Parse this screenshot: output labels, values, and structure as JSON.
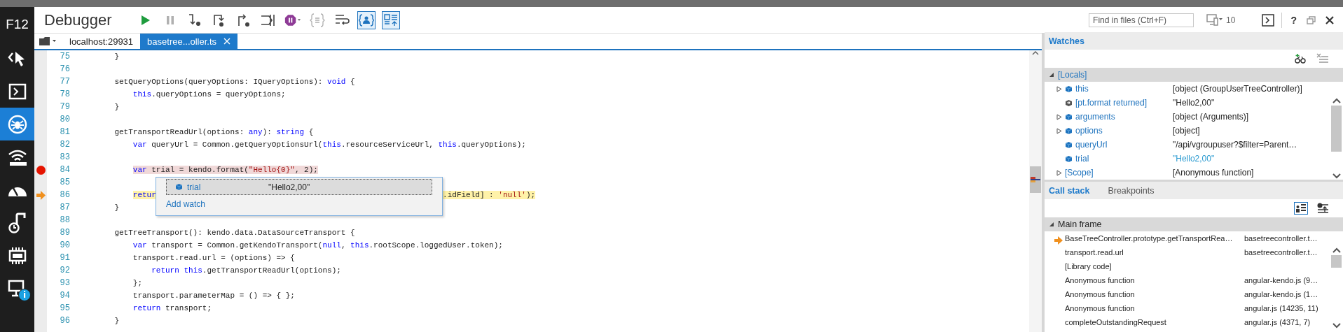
{
  "app_label": "F12",
  "rail": [
    {
      "kind": "pointer",
      "selected": false
    },
    {
      "kind": "console",
      "selected": false
    },
    {
      "kind": "debugger",
      "selected": true
    },
    {
      "kind": "network",
      "selected": false
    },
    {
      "kind": "performance",
      "selected": false
    },
    {
      "kind": "memory",
      "selected": false
    },
    {
      "kind": "emulation",
      "selected": false
    },
    {
      "kind": "devices",
      "selected": false,
      "badge": "i"
    }
  ],
  "title": "Debugger",
  "toolbar": [
    {
      "kind": "continue",
      "disabled": false,
      "on": false
    },
    {
      "kind": "break",
      "disabled": true,
      "on": false
    },
    {
      "kind": "step-into",
      "disabled": false,
      "on": false
    },
    {
      "kind": "step-over",
      "disabled": false,
      "on": false
    },
    {
      "kind": "step-out",
      "disabled": false,
      "on": false
    },
    {
      "kind": "break-worker",
      "disabled": false,
      "on": false
    },
    {
      "kind": "exceptions",
      "disabled": false,
      "on": false
    },
    {
      "kind": "pretty-print",
      "disabled": true,
      "on": false
    },
    {
      "kind": "word-wrap",
      "disabled": false,
      "on": false
    },
    {
      "kind": "just-my-code",
      "disabled": false,
      "on": true
    },
    {
      "kind": "source-maps",
      "disabled": false,
      "on": true
    }
  ],
  "search": {
    "placeholder": "Find in files (Ctrl+F)"
  },
  "target": {
    "label": "10"
  },
  "help": "?",
  "file_tabs": [
    {
      "label": "localhost:29931",
      "selected": false,
      "closable": false
    },
    {
      "label": "basetree...oller.ts",
      "selected": true,
      "closable": true
    }
  ],
  "code": {
    "lines": [
      {
        "n": "75",
        "breakpoint": false,
        "current": false,
        "tokens": [
          {
            "t": "    }",
            "kind": "plain"
          }
        ]
      },
      {
        "n": "76",
        "breakpoint": false,
        "current": false
      },
      {
        "n": "77",
        "breakpoint": false,
        "current": false,
        "tokens": [
          {
            "t": "    setQueryOptions(queryOptions: IQueryOptions): ",
            "kind": "plain"
          },
          {
            "t": "void",
            "kind": "keyword"
          },
          {
            "t": " {",
            "kind": "plain"
          }
        ]
      },
      {
        "n": "78",
        "breakpoint": false,
        "current": false,
        "tokens": [
          {
            "t": "        this",
            "kind": "keyword"
          },
          {
            "t": ".queryOptions = queryOptions;",
            "kind": "plain"
          }
        ]
      },
      {
        "n": "79",
        "breakpoint": false,
        "current": false,
        "tokens": [
          {
            "t": "    }",
            "kind": "plain"
          }
        ]
      },
      {
        "n": "80",
        "breakpoint": false,
        "current": false
      },
      {
        "n": "81",
        "breakpoint": false,
        "current": false,
        "tokens": [
          {
            "t": "    getTransportReadUrl(options: ",
            "kind": "plain"
          },
          {
            "t": "any",
            "kind": "keyword"
          },
          {
            "t": "): ",
            "kind": "plain"
          },
          {
            "t": "string",
            "kind": "keyword"
          },
          {
            "t": " {",
            "kind": "plain"
          }
        ]
      },
      {
        "n": "82",
        "breakpoint": false,
        "current": false,
        "tokens": [
          {
            "t": "        var",
            "kind": "keyword"
          },
          {
            "t": " queryUrl = Common.getQueryOptionsUrl(",
            "kind": "plain"
          },
          {
            "t": "this",
            "kind": "keyword"
          },
          {
            "t": ".resourceServiceUrl, ",
            "kind": "plain"
          },
          {
            "t": "this",
            "kind": "keyword"
          },
          {
            "t": ".queryOptions);",
            "kind": "plain"
          }
        ]
      },
      {
        "n": "83",
        "breakpoint": false,
        "current": false
      },
      {
        "n": "84",
        "breakpoint": true,
        "current": false,
        "tokens": [
          {
            "t": "        var",
            "kind": "keyword"
          },
          {
            "t": " trial = kendo.format(",
            "kind": "plain"
          },
          {
            "t": "\"Hello{0}\"",
            "kind": "string"
          },
          {
            "t": ", 2);",
            "kind": "plain"
          }
        ]
      },
      {
        "n": "85",
        "breakpoint": false,
        "current": false
      },
      {
        "n": "86",
        "breakpoint": false,
        "current": true,
        "tokens": [
          {
            "t": "        retur",
            "kind": "keyword"
          }
        ],
        "tail": [
          {
            "t": ".idField] : ",
            "kind": "plain"
          },
          {
            "t": "'null'",
            "kind": "string"
          },
          {
            "t": ");",
            "kind": "plain"
          }
        ]
      },
      {
        "n": "87",
        "breakpoint": false,
        "current": false,
        "tokens": [
          {
            "t": "    }",
            "kind": "plain"
          }
        ]
      },
      {
        "n": "88",
        "breakpoint": false,
        "current": false
      },
      {
        "n": "89",
        "breakpoint": false,
        "current": false,
        "tokens": [
          {
            "t": "    getTreeTransport(): kendo.data.DataSourceTransport {",
            "kind": "plain"
          }
        ]
      },
      {
        "n": "90",
        "breakpoint": false,
        "current": false,
        "tokens": [
          {
            "t": "        var",
            "kind": "keyword"
          },
          {
            "t": " transport = Common.getKendoTransport(",
            "kind": "plain"
          },
          {
            "t": "null",
            "kind": "keyword"
          },
          {
            "t": ", ",
            "kind": "plain"
          },
          {
            "t": "this",
            "kind": "keyword"
          },
          {
            "t": ".rootScope.loggedUser.token);",
            "kind": "plain"
          }
        ]
      },
      {
        "n": "91",
        "breakpoint": false,
        "current": false,
        "tokens": [
          {
            "t": "        transport.read.url = (options) => {",
            "kind": "plain"
          }
        ]
      },
      {
        "n": "92",
        "breakpoint": false,
        "current": false,
        "tokens": [
          {
            "t": "            return this",
            "kind": "keyword"
          },
          {
            "t": ".getTransportReadUrl(options);",
            "kind": "plain"
          }
        ]
      },
      {
        "n": "93",
        "breakpoint": false,
        "current": false,
        "tokens": [
          {
            "t": "        };",
            "kind": "plain"
          }
        ]
      },
      {
        "n": "94",
        "breakpoint": false,
        "current": false,
        "tokens": [
          {
            "t": "        transport.parameterMap = () => { };",
            "kind": "plain"
          }
        ]
      },
      {
        "n": "95",
        "breakpoint": false,
        "current": false,
        "tokens": [
          {
            "t": "        return",
            "kind": "keyword"
          },
          {
            "t": " transport;",
            "kind": "plain"
          }
        ]
      },
      {
        "n": "96",
        "breakpoint": false,
        "current": false,
        "tokens": [
          {
            "t": "    }",
            "kind": "plain"
          }
        ]
      }
    ]
  },
  "datatip": {
    "name": "trial",
    "value": "\"Hello2,00\"",
    "action": "Add watch"
  },
  "watches": {
    "title": "Watches",
    "scope": {
      "label": "[Locals]",
      "expanded": true,
      "selected": true,
      "children": [
        {
          "name": "this",
          "value": "[object (GroupUserTreeController)]",
          "kind": "object",
          "expanded": false,
          "changed": false
        },
        {
          "name": "[pt.format returned]",
          "value": "\"Hello2,00\"",
          "kind": "returned",
          "changed": false
        },
        {
          "name": "arguments",
          "value": "[object (Arguments)]",
          "kind": "object",
          "expanded": false,
          "changed": false
        },
        {
          "name": "options",
          "value": "[object]",
          "kind": "object",
          "expanded": false,
          "changed": false
        },
        {
          "name": "queryUrl",
          "value": "\"/api/vgroupuser?$filter=Parent…",
          "kind": "value",
          "changed": false
        },
        {
          "name": "trial",
          "value": "\"Hello2,00\"",
          "kind": "value",
          "changed": true
        },
        {
          "name": "[Scope]",
          "value": "[Anonymous function]",
          "kind": "scope",
          "expanded": false,
          "changed": false
        }
      ]
    }
  },
  "call_stack": {
    "tabs": [
      {
        "label": "Call stack",
        "selected": true
      },
      {
        "label": "Breakpoints",
        "selected": false
      }
    ],
    "group": {
      "label": "Main frame",
      "expanded": true
    },
    "frames": [
      {
        "name": "BaseTreeController.prototype.getTransportRea…",
        "location": "basetreecontroller.t…",
        "current": true
      },
      {
        "name": "transport.read.url",
        "location": "basetreecontroller.t…",
        "current": false
      },
      {
        "name": "[Library code]",
        "current": false
      },
      {
        "name": "Anonymous function",
        "location": "angular-kendo.js (9…",
        "current": false
      },
      {
        "name": "Anonymous function",
        "location": "angular-kendo.js (1…",
        "current": false
      },
      {
        "name": "Anonymous function",
        "location": "angular.js (14235, 11)",
        "current": false
      },
      {
        "name": "completeOutstandingRequest",
        "location": "angular.js (4371, 7)",
        "current": false
      }
    ]
  }
}
